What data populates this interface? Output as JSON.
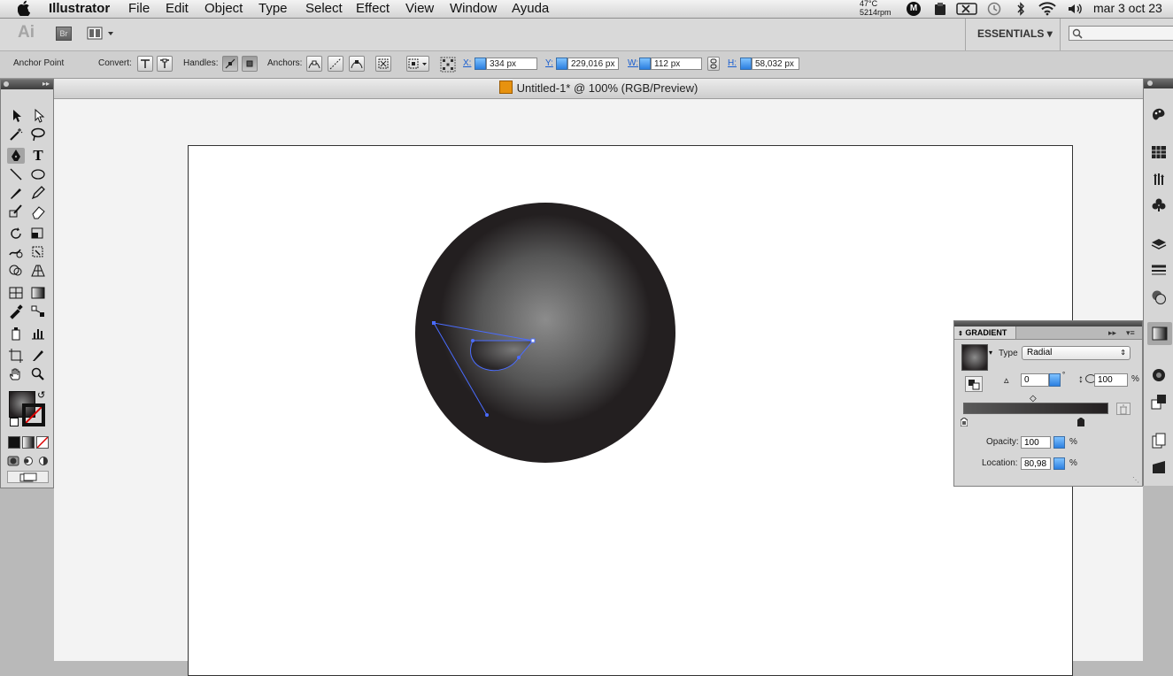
{
  "menubar": {
    "app_name": "Illustrator",
    "items": [
      "File",
      "Edit",
      "Object",
      "Type",
      "Select",
      "Effect",
      "View",
      "Window",
      "Ayuda"
    ],
    "temp": "47°C",
    "rpm": "5214rpm",
    "clock": "mar 3 oct  23"
  },
  "appbar": {
    "logo": "Ai",
    "bridge": "Br",
    "workspace": "ESSENTIALS"
  },
  "control": {
    "mode_label": "Anchor Point",
    "convert_label": "Convert:",
    "handles_label": "Handles:",
    "anchors_label": "Anchors:",
    "x_label": "X:",
    "x_value": "334 px",
    "y_label": "Y:",
    "y_value": "229,016 px",
    "w_label": "W:",
    "w_value": "112 px",
    "h_label": "H:",
    "h_value": "58,032 px"
  },
  "document": {
    "title": "Untitled-1* @ 100% (RGB/Preview)"
  },
  "tools": {
    "type_tool_glyph": "T"
  },
  "gradient_panel": {
    "title": "GRADIENT",
    "type_label": "Type",
    "type_value": "Radial",
    "angle_value": "0",
    "aspect_value": "100",
    "percent": "%",
    "opacity_label": "Opacity:",
    "opacity_value": "100",
    "location_label": "Location:",
    "location_value": "80,98"
  },
  "colors": {
    "selection": "#4a6cff",
    "sphere_dark": "#231f20",
    "sphere_light": "#8a8a8a"
  }
}
